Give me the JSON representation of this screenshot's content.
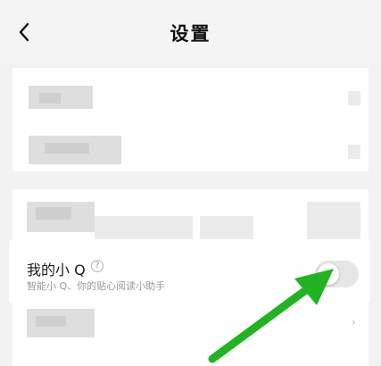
{
  "header": {
    "title": "设置",
    "back_icon": "chevron-left-icon"
  },
  "xiaoq": {
    "label": "我的小 Q",
    "help_glyph": "?",
    "subtitle": "智能小 Q、你的贴心阅读小助手",
    "toggle_on": false
  },
  "list_chevron": "›",
  "colors": {
    "annotation_arrow": "#22b322",
    "toggle_off_track": "#e6e6e6"
  }
}
